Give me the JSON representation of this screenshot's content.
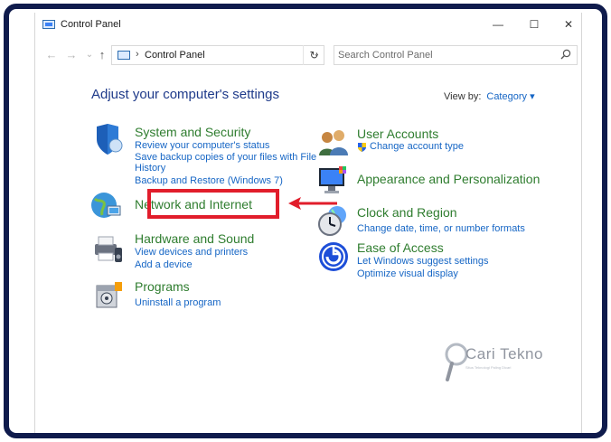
{
  "window": {
    "title": "Control Panel",
    "minimize": "—",
    "maximize": "☐",
    "close": "✕"
  },
  "nav": {
    "back": "←",
    "forward": "→",
    "recent": "⌄",
    "up": "↑",
    "breadcrumb": "Control Panel",
    "breadcrumb_sep": "›",
    "refresh": "↻"
  },
  "search": {
    "placeholder": "Search Control Panel"
  },
  "main": {
    "heading": "Adjust your computer's settings",
    "view_by_label": "View by:",
    "view_by_value": "Category ▾"
  },
  "categories": {
    "system": {
      "title": "System and Security",
      "links": [
        "Review your computer's status",
        "Save backup copies of your files with File",
        "History",
        "Backup and Restore (Windows 7)"
      ]
    },
    "network": {
      "title": "Network and Internet"
    },
    "hardware": {
      "title": "Hardware and Sound",
      "links": [
        "View devices and printers",
        "Add a device"
      ]
    },
    "programs": {
      "title": "Programs",
      "links": [
        "Uninstall a program"
      ]
    },
    "users": {
      "title": "User Accounts",
      "links": [
        "Change account type"
      ]
    },
    "appearance": {
      "title": "Appearance and Personalization"
    },
    "clock": {
      "title": "Clock and Region",
      "links": [
        "Change date, time, or number formats"
      ]
    },
    "ease": {
      "title": "Ease of Access",
      "links": [
        "Let Windows suggest settings",
        "Optimize visual display"
      ]
    }
  },
  "watermark": {
    "name": "Cari Tekno",
    "tagline": "Situs Teknologi Paling Dicari"
  },
  "colors": {
    "frame": "#0f1b4c",
    "link": "#1666c5",
    "category": "#2f7d2f",
    "heading": "#1e3a8a",
    "highlight": "#e11d2b"
  }
}
